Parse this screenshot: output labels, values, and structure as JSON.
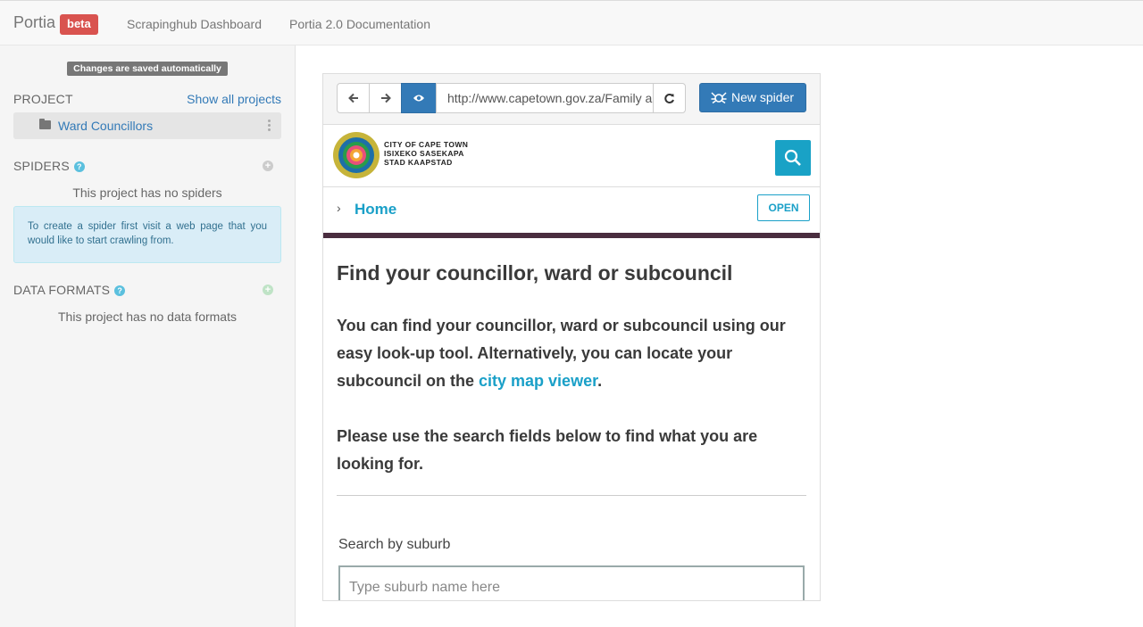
{
  "nav": {
    "brand": "Portia",
    "badge": "beta",
    "links": [
      "Scrapinghub Dashboard",
      "Portia 2.0 Documentation"
    ]
  },
  "sidebar": {
    "saved_notice": "Changes are saved automatically",
    "project_title": "PROJECT",
    "show_all": "Show all projects",
    "project_name": "Ward Councillors",
    "spiders_title": "SPIDERS",
    "spiders_empty": "This project has no spiders",
    "spiders_info": "To create a spider first visit a web page that you would like to start crawling from.",
    "formats_title": "DATA FORMATS",
    "formats_empty": "This project has no data formats"
  },
  "browser": {
    "url": "http://www.capetown.gov.za/Family and home/",
    "new_spider": "New spider"
  },
  "site": {
    "logo_lines": [
      "CITY OF CAPE TOWN",
      "ISIXEKO SASEKAPA",
      "STAD KAAPSTAD"
    ],
    "breadcrumb": "Home",
    "open_label": "OPEN",
    "heading": "Find your councillor, ward or subcouncil",
    "para1": "You can find your councillor, ward or subcouncil using our easy look-up tool. Alternatively, you can locate your subcouncil on the ",
    "para1_link": "city map viewer",
    "para1_end": ".",
    "para2": "Please use the search fields below to find what you are looking for.",
    "search_label": "Search by suburb",
    "search_placeholder": "Type suburb name here"
  },
  "colors": {
    "beta_badge": "#d9534f",
    "primary": "#337ab7",
    "site_accent": "#1aa0c8",
    "site_bar": "#4a2d3f"
  }
}
